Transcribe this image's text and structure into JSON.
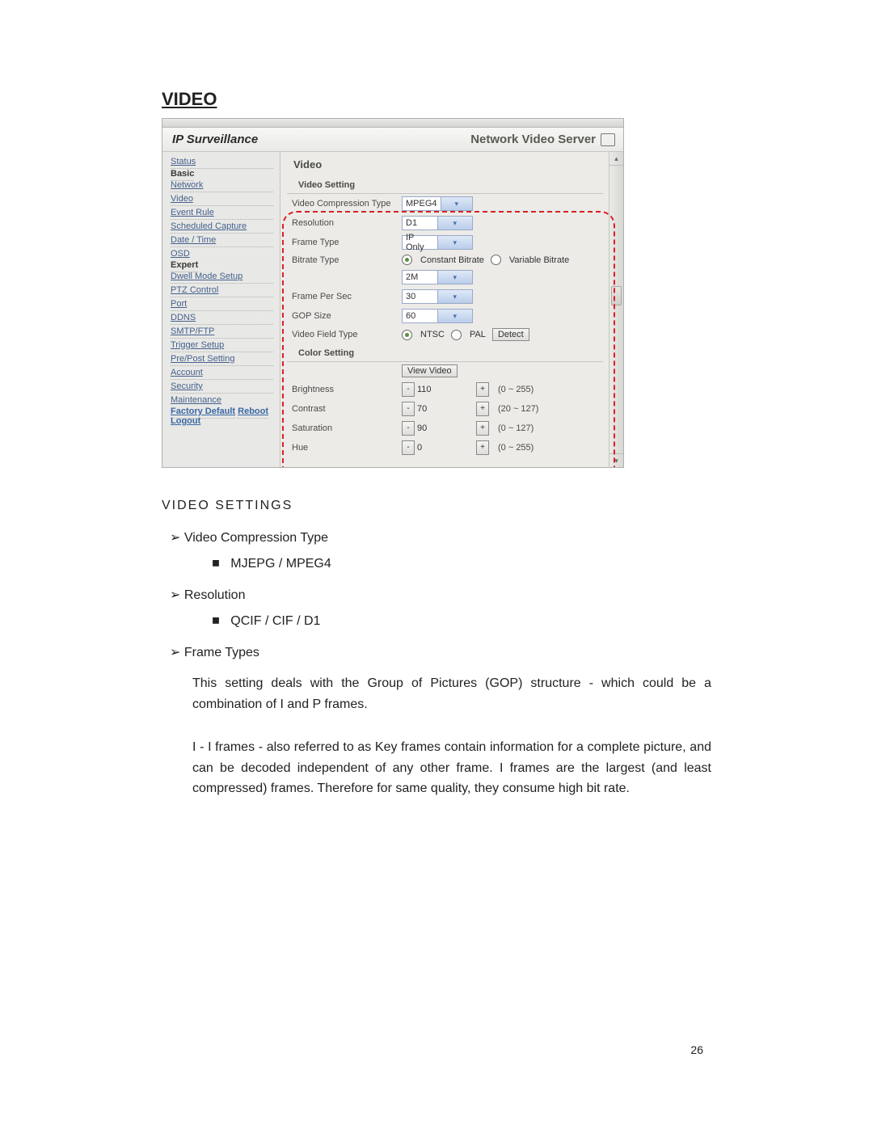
{
  "doc": {
    "heading": "VIDEO",
    "subheading": "VIDEO SETTINGS",
    "page_number": "26",
    "items": {
      "vct": "Video Compression Type",
      "vct_opts": "MJEPG / MPEG4",
      "res": "Resolution",
      "res_opts": "QCIF / CIF / D1",
      "ft": "Frame Types",
      "ft_p1": "This setting deals with the Group of Pictures (GOP) structure - which could be a combination of I and P frames.",
      "ft_p2": "I  -  I frames - also referred to as Key frames contain information for a complete picture, and can be decoded independent of any other frame. I frames are the largest (and least compressed) frames. Therefore for same quality, they consume high bit rate."
    }
  },
  "app": {
    "logo": "IP Surveillance",
    "title": "Network Video Server"
  },
  "sidebar": {
    "status": "Status",
    "basic": "Basic",
    "network": "Network",
    "video": "Video",
    "event_rule": "Event Rule",
    "sched_cap": "Scheduled Capture",
    "date_time": "Date / Time",
    "osd": "OSD",
    "expert": "Expert",
    "dwell": "Dwell Mode Setup",
    "ptz": "PTZ Control",
    "port": "Port",
    "ddns": "DDNS",
    "smtp": "SMTP/FTP",
    "trigger": "Trigger Setup",
    "prepost": "Pre/Post Setting",
    "account": "Account",
    "security": "Security",
    "maint": "Maintenance",
    "factory": "Factory Default",
    "reboot": "Reboot",
    "logout": "Logout"
  },
  "panel": {
    "title": "Video",
    "group_video": "Video Setting",
    "group_color": "Color Setting",
    "rows": {
      "compression": {
        "label": "Video Compression Type",
        "value": "MPEG4"
      },
      "resolution": {
        "label": "Resolution",
        "value": "D1"
      },
      "frametype": {
        "label": "Frame Type",
        "value": "IP Only"
      },
      "bitrate_type": {
        "label": "Bitrate Type",
        "opt1": "Constant Bitrate",
        "opt2": "Variable Bitrate",
        "value": "2M"
      },
      "fps": {
        "label": "Frame Per Sec",
        "value": "30"
      },
      "gop": {
        "label": "GOP Size",
        "value": "60"
      },
      "field": {
        "label": "Video Field Type",
        "ntsc": "NTSC",
        "pal": "PAL",
        "detect": "Detect"
      },
      "view": "View Video",
      "brightness": {
        "label": "Brightness",
        "value": "110",
        "range": "(0 ~ 255)"
      },
      "contrast": {
        "label": "Contrast",
        "value": "70",
        "range": "(20 ~ 127)"
      },
      "saturation": {
        "label": "Saturation",
        "value": "90",
        "range": "(0 ~ 127)"
      },
      "hue": {
        "label": "Hue",
        "value": "0",
        "range": "(0 ~ 255)"
      }
    }
  }
}
